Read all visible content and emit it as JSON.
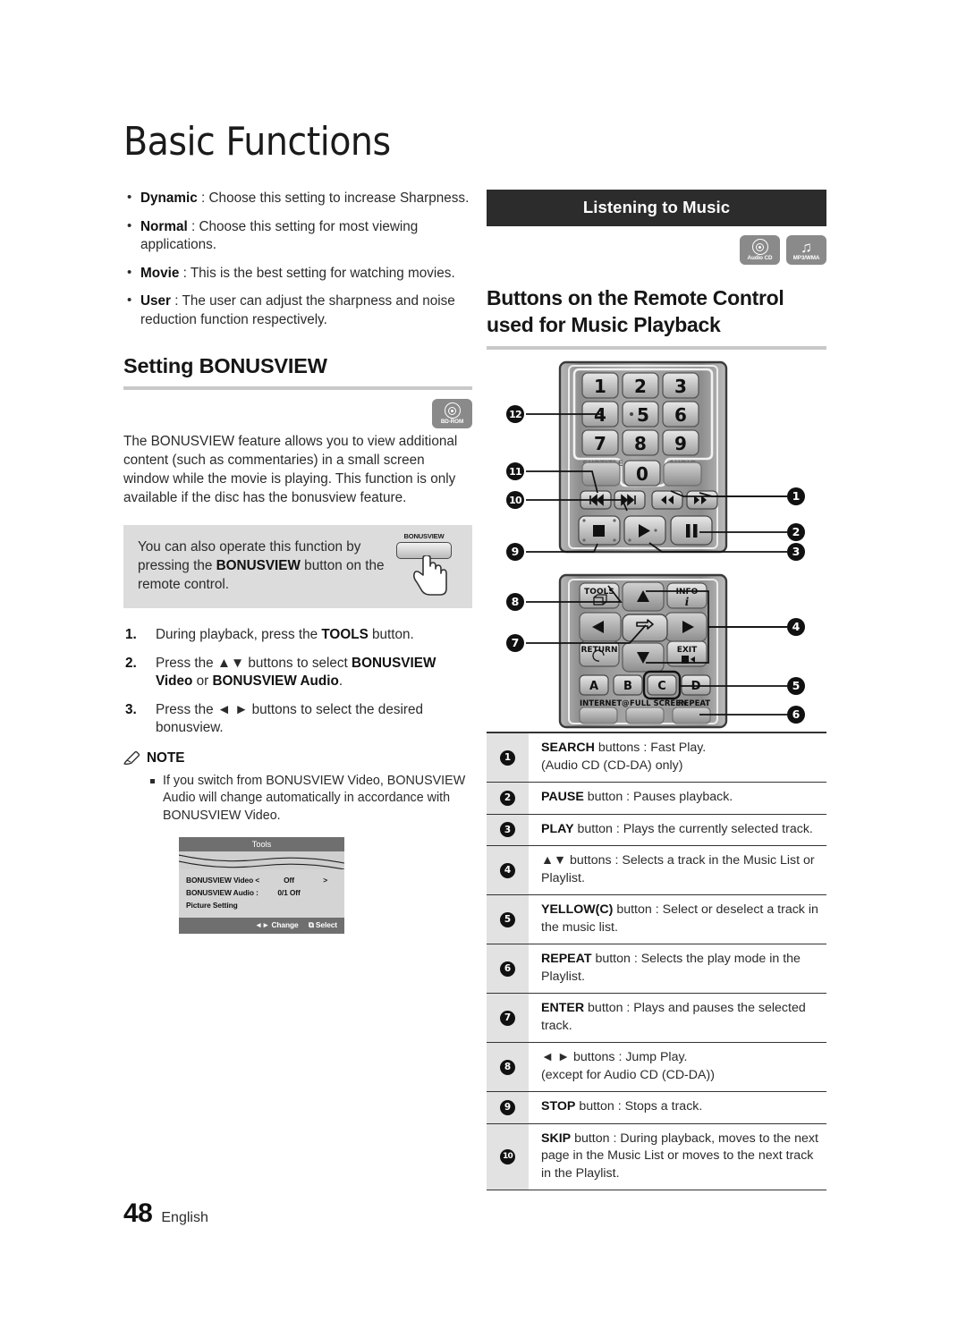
{
  "page": {
    "chapter_title": "Basic Functions",
    "page_number": "48",
    "language": "English"
  },
  "left_column": {
    "picture_mode_bullets": [
      {
        "term": "Dynamic",
        "text": " : Choose this setting to increase Sharpness."
      },
      {
        "term": "Normal",
        "text": " : Choose this setting for most viewing applications."
      },
      {
        "term": "Movie",
        "text": " : This is the best setting for watching movies."
      },
      {
        "term": "User",
        "text": " : The user can adjust the sharpness and noise reduction function respectively."
      }
    ],
    "section_heading": "Setting BONUSVIEW",
    "media_badge": {
      "icon": "bd-rom-disc-icon",
      "label": "BD-ROM"
    },
    "paragraph": "The BONUSVIEW feature allows you to view additional content (such as commentaries) in a small screen window while the movie is playing. This function is only available if the disc has the bonusview feature.",
    "tip_box": {
      "text_before": "You can also operate this function by pressing the ",
      "text_bold": "BONUSVIEW",
      "text_after": " button on the remote control.",
      "remote_key_label": "BONUSVIEW"
    },
    "steps": [
      {
        "num": "1.",
        "parts": [
          {
            "t": "During playback, press the ",
            "b": false
          },
          {
            "t": "TOOLS",
            "b": true
          },
          {
            "t": " button.",
            "b": false
          }
        ]
      },
      {
        "num": "2.",
        "parts": [
          {
            "t": "Press the ▲▼ buttons to select ",
            "b": false
          },
          {
            "t": "BONUSVIEW Video",
            "b": true
          },
          {
            "t": " or ",
            "b": false
          },
          {
            "t": "BONUSVIEW Audio",
            "b": true
          },
          {
            "t": ".",
            "b": false
          }
        ]
      },
      {
        "num": "3.",
        "parts": [
          {
            "t": "Press the ◄ ► buttons to select the desired bonusview.",
            "b": false
          }
        ]
      }
    ],
    "note": {
      "heading": "NOTE",
      "items": [
        "If you switch from BONUSVIEW Video, BONUSVIEW Audio will change automatically in accordance with BONUSVIEW Video."
      ]
    },
    "osd": {
      "title": "Tools",
      "rows": [
        {
          "key": "BONUSVIEW Video <",
          "value": "Off",
          "arrow": ">"
        },
        {
          "key": "BONUSVIEW Audio :",
          "value": "0/1 Off",
          "arrow": ""
        },
        {
          "key": "Picture Setting",
          "value": "",
          "arrow": ""
        }
      ],
      "footer_change": "◄► Change",
      "footer_select": "⧉ Select"
    }
  },
  "right_column": {
    "bar_heading": "Listening to Music",
    "media_badges": [
      {
        "icon": "audio-cd-disc-icon",
        "label": "Audio CD"
      },
      {
        "icon": "music-note-icon",
        "label": "MP3/WMA"
      }
    ],
    "section_title": "Buttons on the Remote Control used for Music Playback",
    "remote": {
      "keypad": [
        "1",
        "2",
        "3",
        "4",
        "5",
        "6",
        "7",
        "8",
        "9",
        "0"
      ],
      "labels": {
        "subtitle": "SUBTITLE",
        "audio": "AUDIO",
        "tools": "TOOLS",
        "info": "INFO",
        "return": "RETURN",
        "exit": "EXIT",
        "color_a": "A",
        "color_b": "B",
        "color_c": "C",
        "color_d": "D",
        "internet": "INTERNET@",
        "full_screen": "FULL SCREEN",
        "repeat": "REPEAT"
      },
      "callouts_left": [
        "12",
        "11",
        "10",
        "9",
        "8",
        "7"
      ],
      "callouts_right": [
        "1",
        "2",
        "3",
        "4",
        "5",
        "6"
      ]
    }
  },
  "legend": [
    {
      "index": "1",
      "parts": [
        {
          "t": "SEARCH",
          "b": true
        },
        {
          "t": " buttons : Fast Play.\n(Audio CD (CD-DA) only)",
          "b": false
        }
      ]
    },
    {
      "index": "2",
      "parts": [
        {
          "t": "PAUSE",
          "b": true
        },
        {
          "t": " button : Pauses playback.",
          "b": false
        }
      ]
    },
    {
      "index": "3",
      "parts": [
        {
          "t": "PLAY",
          "b": true
        },
        {
          "t": " button : Plays the currently selected track.",
          "b": false
        }
      ]
    },
    {
      "index": "4",
      "parts": [
        {
          "t": "▲▼ buttons : Selects a track in the Music List or Playlist.",
          "b": false
        }
      ]
    },
    {
      "index": "5",
      "parts": [
        {
          "t": "YELLOW(C)",
          "b": true
        },
        {
          "t": " button : Select or deselect a track in the music list.",
          "b": false
        }
      ]
    },
    {
      "index": "6",
      "parts": [
        {
          "t": "REPEAT",
          "b": true
        },
        {
          "t": " button : Selects the play mode in the Playlist.",
          "b": false
        }
      ]
    },
    {
      "index": "7",
      "parts": [
        {
          "t": "ENTER",
          "b": true
        },
        {
          "t": " button : Plays and pauses the selected track.",
          "b": false
        }
      ]
    },
    {
      "index": "8",
      "parts": [
        {
          "t": "◄ ► buttons : Jump Play.\n(except for Audio CD (CD-DA))",
          "b": false
        }
      ]
    },
    {
      "index": "9",
      "parts": [
        {
          "t": "STOP",
          "b": true
        },
        {
          "t": " button : Stops a track.",
          "b": false
        }
      ]
    },
    {
      "index": "10",
      "parts": [
        {
          "t": "SKIP",
          "b": true
        },
        {
          "t": " button : During playback, moves to the next page in the Music List or moves to the next track in the Playlist.",
          "b": false
        }
      ]
    }
  ],
  "colors": {
    "bar_bg": "#2c2c2c",
    "rule": "#c9c9c9",
    "tip_bg": "#dcdcdc",
    "badge_bg": "#8a8a8a",
    "legend_idx_bg": "#e2e2e2",
    "text": "#2b2b2b"
  }
}
